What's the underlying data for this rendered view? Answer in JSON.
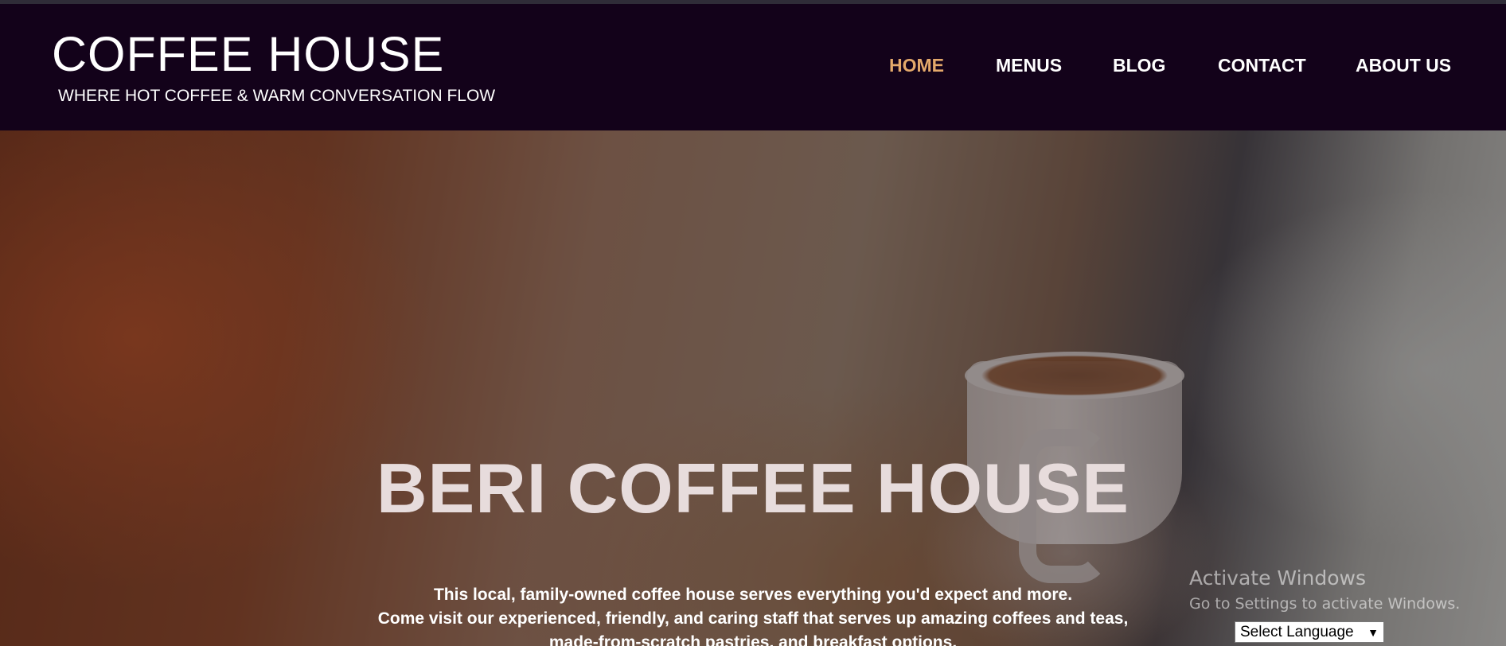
{
  "header": {
    "title": "COFFEE HOUSE",
    "tagline": "WHERE HOT COFFEE & WARM CONVERSATION FLOW",
    "nav": [
      {
        "label": "HOME",
        "active": true
      },
      {
        "label": "MENUS",
        "active": false
      },
      {
        "label": "BLOG",
        "active": false
      },
      {
        "label": "CONTACT",
        "active": false
      },
      {
        "label": "ABOUT US",
        "active": false
      }
    ]
  },
  "hero": {
    "title": "BERI COFFEE HOUSE",
    "lines": [
      "This local, family-owned coffee house serves everything you'd expect and more.",
      "Come visit our experienced, friendly, and caring staff that serves up amazing coffees and teas,",
      "made-from-scratch pastries, and breakfast options."
    ]
  },
  "windows_notice": {
    "line1": "Activate Windows",
    "line2": "Go to Settings to activate Windows."
  },
  "language_select": {
    "selected": "Select Language",
    "caret": "▼"
  },
  "colors": {
    "header_bg": "#13021a",
    "nav_active": "#e4a96b",
    "nav_text": "#ffffff"
  }
}
